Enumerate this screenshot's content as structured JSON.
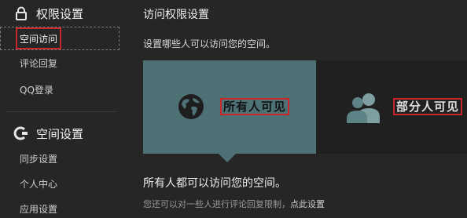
{
  "sidebar": {
    "sections": [
      {
        "title": "权限设置",
        "icon": "lock-icon",
        "items": [
          {
            "label": "空间访问",
            "active": true
          },
          {
            "label": "评论回复",
            "active": false
          },
          {
            "label": "QQ登录",
            "active": false
          }
        ]
      },
      {
        "title": "空间设置",
        "icon": "settings-icon",
        "items": [
          {
            "label": "同步设置",
            "active": false
          },
          {
            "label": "个人中心",
            "active": false
          },
          {
            "label": "应用设置",
            "active": false
          }
        ]
      }
    ]
  },
  "main": {
    "title": "访问权限设置",
    "description": "设置哪些人可以访问您的空间。",
    "options": [
      {
        "label": "所有人可见",
        "icon": "globe-icon",
        "selected": true
      },
      {
        "label": "部分人可见",
        "icon": "people-icon",
        "selected": false
      }
    ],
    "result_text": "所有人都可以访问您的空间。",
    "hint_text": "您还可以对一些人进行评论回复限制，",
    "hint_link": "点此设置"
  },
  "colors": {
    "background": "#262626",
    "selected_option": "#4d7175",
    "unselected_option": "#202020",
    "highlight_box": "#c8282b"
  }
}
